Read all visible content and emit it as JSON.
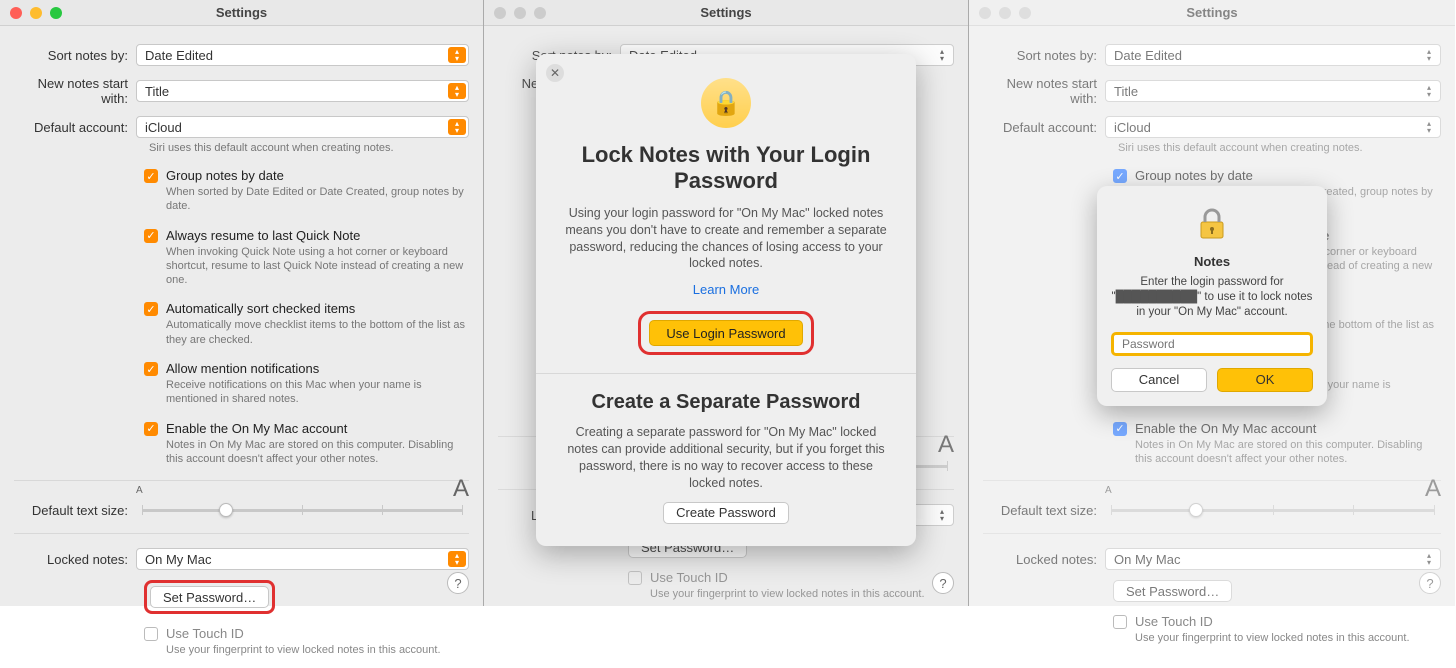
{
  "window_title": "Settings",
  "labels": {
    "sort_by": "Sort notes by:",
    "new_notes": "New notes start with:",
    "default_account": "Default account:",
    "default_text_size": "Default text size:",
    "locked_notes": "Locked notes:"
  },
  "selects": {
    "sort_by": "Date Edited",
    "new_notes": "Title",
    "default_account": "iCloud",
    "locked_notes": "On My Mac"
  },
  "default_account_helper": "Siri uses this default account when creating notes.",
  "checks": {
    "group": {
      "title": "Group notes by date",
      "desc": "When sorted by Date Edited or Date Created, group notes by date."
    },
    "quicknote": {
      "title": "Always resume to last Quick Note",
      "desc": "When invoking Quick Note using a hot corner or keyboard shortcut, resume to last Quick Note instead of creating a new one."
    },
    "autosort": {
      "title": "Automatically sort checked items",
      "desc": "Automatically move checklist items to the bottom of the list as they are checked."
    },
    "mention": {
      "title": "Allow mention notifications",
      "desc": "Receive notifications on this Mac when your name is mentioned in shared notes."
    },
    "onmymac": {
      "title": "Enable the On My Mac account",
      "desc": "Notes in On My Mac are stored on this computer. Disabling this account doesn't affect your other notes."
    }
  },
  "set_password_btn": "Set Password…",
  "touch_id": {
    "title": "Use Touch ID",
    "desc": "Use your fingerprint to view locked notes in this account."
  },
  "small_a": "A",
  "big_a": "A",
  "help": "?",
  "modal": {
    "lock_title": "Lock Notes with Your Login Password",
    "lock_body": "Using your login password for \"On My Mac\" locked notes means you don't have to create and remember a separate password, reducing the chances of losing access to your locked notes.",
    "learn_more": "Learn More",
    "use_login_btn": "Use Login Password",
    "sep_title": "Create a Separate Password",
    "sep_body": "Creating a separate password for \"On My Mac\" locked notes can provide additional security, but if you forget this password, there is no way to recover access to these locked notes.",
    "create_btn": "Create Password"
  },
  "dialog": {
    "title": "Notes",
    "msg_pre": "Enter the login password for \"",
    "msg_mid": "\" to use it to lock notes in your \"On My Mac\" account.",
    "placeholder": "Password",
    "cancel": "Cancel",
    "ok": "OK"
  }
}
